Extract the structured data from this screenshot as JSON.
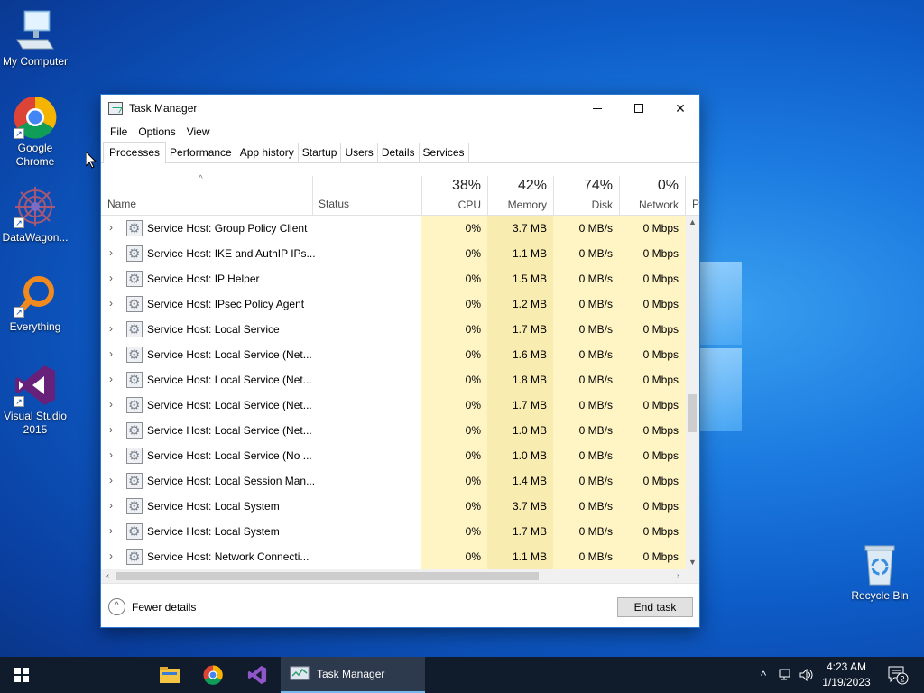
{
  "desktop": {
    "icons": [
      {
        "label": "My Computer",
        "icon": "computer-icon"
      },
      {
        "label": "Google Chrome",
        "icon": "chrome-icon"
      },
      {
        "label": "DataWagon...",
        "icon": "datawagon-icon"
      },
      {
        "label": "Everything",
        "icon": "everything-search-icon"
      },
      {
        "label": "Visual Studio 2015",
        "icon": "visual-studio-icon"
      },
      {
        "label": "Recycle Bin",
        "icon": "recycle-bin-icon"
      }
    ]
  },
  "window": {
    "title": "Task Manager",
    "menu": [
      "File",
      "Options",
      "View"
    ],
    "tabs": [
      "Processes",
      "Performance",
      "App history",
      "Startup",
      "Users",
      "Details",
      "Services"
    ],
    "active_tab": "Processes",
    "columns": {
      "name": "Name",
      "status": "Status",
      "cpu": {
        "pct": "38%",
        "label": "CPU"
      },
      "memory": {
        "pct": "42%",
        "label": "Memory"
      },
      "disk": {
        "pct": "74%",
        "label": "Disk"
      },
      "network": {
        "pct": "0%",
        "label": "Network"
      },
      "partial": "P"
    },
    "processes": [
      {
        "name": "Service Host: Group Policy Client",
        "cpu": "0%",
        "memory": "3.7 MB",
        "disk": "0 MB/s",
        "network": "0 Mbps"
      },
      {
        "name": "Service Host: IKE and AuthIP IPs...",
        "cpu": "0%",
        "memory": "1.1 MB",
        "disk": "0 MB/s",
        "network": "0 Mbps"
      },
      {
        "name": "Service Host: IP Helper",
        "cpu": "0%",
        "memory": "1.5 MB",
        "disk": "0 MB/s",
        "network": "0 Mbps"
      },
      {
        "name": "Service Host: IPsec Policy Agent",
        "cpu": "0%",
        "memory": "1.2 MB",
        "disk": "0 MB/s",
        "network": "0 Mbps"
      },
      {
        "name": "Service Host: Local Service",
        "cpu": "0%",
        "memory": "1.7 MB",
        "disk": "0 MB/s",
        "network": "0 Mbps"
      },
      {
        "name": "Service Host: Local Service (Net...",
        "cpu": "0%",
        "memory": "1.6 MB",
        "disk": "0 MB/s",
        "network": "0 Mbps"
      },
      {
        "name": "Service Host: Local Service (Net...",
        "cpu": "0%",
        "memory": "1.8 MB",
        "disk": "0 MB/s",
        "network": "0 Mbps"
      },
      {
        "name": "Service Host: Local Service (Net...",
        "cpu": "0%",
        "memory": "1.7 MB",
        "disk": "0 MB/s",
        "network": "0 Mbps"
      },
      {
        "name": "Service Host: Local Service (Net...",
        "cpu": "0%",
        "memory": "1.0 MB",
        "disk": "0 MB/s",
        "network": "0 Mbps"
      },
      {
        "name": "Service Host: Local Service (No ...",
        "cpu": "0%",
        "memory": "1.0 MB",
        "disk": "0 MB/s",
        "network": "0 Mbps"
      },
      {
        "name": "Service Host: Local Session Man...",
        "cpu": "0%",
        "memory": "1.4 MB",
        "disk": "0 MB/s",
        "network": "0 Mbps"
      },
      {
        "name": "Service Host: Local System",
        "cpu": "0%",
        "memory": "3.7 MB",
        "disk": "0 MB/s",
        "network": "0 Mbps"
      },
      {
        "name": "Service Host: Local System",
        "cpu": "0%",
        "memory": "1.7 MB",
        "disk": "0 MB/s",
        "network": "0 Mbps"
      },
      {
        "name": "Service Host: Network Connecti...",
        "cpu": "0%",
        "memory": "1.1 MB",
        "disk": "0 MB/s",
        "network": "0 Mbps"
      }
    ],
    "footer": {
      "fewer_details": "Fewer details",
      "end_task": "End task"
    }
  },
  "taskbar": {
    "pinned": [
      {
        "icon": "windows-start-icon"
      },
      {
        "icon": "file-explorer-icon"
      },
      {
        "icon": "chrome-icon"
      },
      {
        "icon": "visual-studio-icon"
      }
    ],
    "active_app": "Task Manager",
    "clock": {
      "time": "4:23 AM",
      "date": "1/19/2023"
    },
    "notification_count": "2"
  },
  "colors": {
    "heat_light": "#fff4c4",
    "heat_mid": "#f9ecb0",
    "accent": "#0078d7",
    "taskbar": "#101c2c"
  }
}
